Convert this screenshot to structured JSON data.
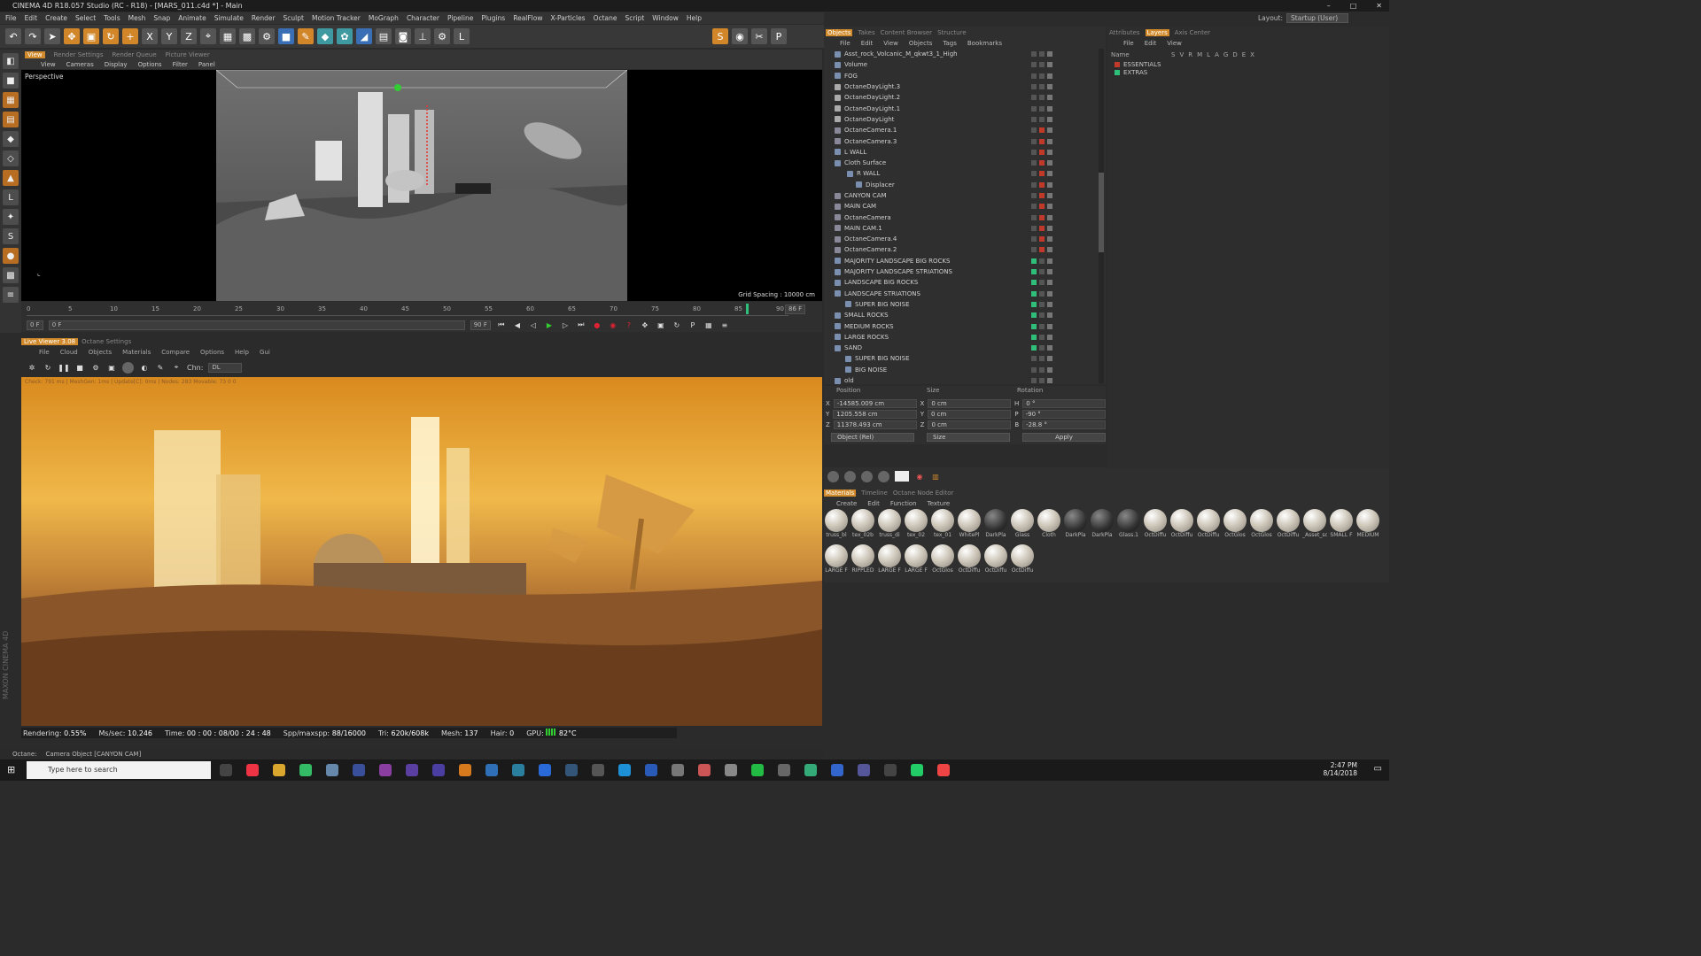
{
  "title": "CINEMA 4D R18.057 Studio (RC - R18) - [MARS_011.c4d *] - Main",
  "menu": [
    "File",
    "Edit",
    "Create",
    "Select",
    "Tools",
    "Mesh",
    "Snap",
    "Animate",
    "Simulate",
    "Render",
    "Sculpt",
    "Motion Tracker",
    "MoGraph",
    "Character",
    "Pipeline",
    "Plugins",
    "RealFlow",
    "X-Particles",
    "Octane",
    "Script",
    "Window",
    "Help"
  ],
  "layout": {
    "label": "Layout:",
    "value": "Startup (User)"
  },
  "vp_tabs": [
    "View",
    "Render Settings",
    "Render Queue",
    "Picture Viewer"
  ],
  "vp_menu": [
    "View",
    "Cameras",
    "Display",
    "Options",
    "Filter",
    "Panel"
  ],
  "viewport": {
    "label": "Perspective",
    "grid": "Grid Spacing : 10000 cm"
  },
  "timeline": {
    "ticks": [
      "0",
      "5",
      "10",
      "15",
      "20",
      "25",
      "30",
      "35",
      "40",
      "45",
      "50",
      "55",
      "60",
      "65",
      "70",
      "75",
      "80",
      "85",
      "90"
    ],
    "current": "86 F",
    "start": "0 F",
    "field1": "0 F",
    "end": "90 F",
    "end2": "90 F"
  },
  "lv_tabs": [
    "Live Viewer 3.08",
    "Octane Settings"
  ],
  "lv_menu": [
    "File",
    "Cloud",
    "Objects",
    "Materials",
    "Compare",
    "Options",
    "Help",
    "Gui"
  ],
  "lv_chn": {
    "label": "Chn:",
    "value": "DL"
  },
  "render_info": "Check: 791 ms | MeshGen: 1ms | Update[C]: 0ms | Nodes: 283 Movable: 73  0 0",
  "stats": {
    "rendering": "Rendering: ",
    "pct": "0.55%",
    "mssec_l": "Ms/sec:",
    "mssec": "10.246",
    "time_l": "Time:",
    "time": "00 : 00 : 08/00 : 24 : 48",
    "spp_l": "Spp/maxspp:",
    "spp": "88/16000",
    "tri_l": "Tri:",
    "tri": "620k/608k",
    "mesh_l": "Mesh:",
    "mesh": "137",
    "hair_l": "Hair:",
    "hair": "0",
    "gpu_l": "GPU:",
    "temp": "82°C"
  },
  "maxon": "MAXON CINEMA 4D",
  "status": {
    "app": "Octane:",
    "msg": "Camera Object [CANYON CAM]"
  },
  "obj_tabs": [
    "Objects",
    "Takes",
    "Content Browser",
    "Structure"
  ],
  "obj_menu": [
    "File",
    "Edit",
    "View",
    "Objects",
    "Tags",
    "Bookmarks"
  ],
  "objects": [
    "Asst_rock_Volcanic_M_qkwt3_1_High",
    "Volume",
    "FOG",
    "OctaneDayLight.3",
    "OctaneDayLight.2",
    "OctaneDayLight.1",
    "OctaneDayLight",
    "OctaneCamera.1",
    "OctaneCamera.3",
    "L WALL",
    "Cloth Surface",
    "R WALL",
    "Displacer",
    "CANYON CAM",
    "MAIN CAM",
    "OctaneCamera",
    "MAIN CAM.1",
    "OctaneCamera.4",
    "OctaneCamera.2",
    "MAJORITY LANDSCAPE BIG ROCKS",
    "MAJORITY LANDSCAPE STRIATIONS",
    "LANDSCAPE BIG ROCKS",
    "LANDSCAPE STRIATIONS",
    "SUPER BIG NOISE",
    "SMALL ROCKS",
    "MEDIUM ROCKS",
    "LARGE ROCKS",
    "SAND",
    "SUPER BIG NOISE",
    "BIG NOISE",
    "old"
  ],
  "coords": {
    "h_pos": "Position",
    "h_size": "Size",
    "h_rot": "Rotation",
    "x": "-14585.009 cm",
    "y": "1205.558 cm",
    "z": "11378.493 cm",
    "sx": "0 cm",
    "sy": "0 cm",
    "sz": "0 cm",
    "h": "0 °",
    "p": "-90 °",
    "b": "-28.8 °",
    "lx": "X",
    "ly": "Y",
    "lz": "Z",
    "lsx": "X",
    "lsy": "Y",
    "lsz": "Z",
    "lh": "H",
    "lp": "P",
    "lb": "B",
    "mode": "Object (Rel)",
    "sizemode": "Size",
    "apply": "Apply"
  },
  "mat_tabs": [
    "Materials",
    "Timeline",
    "Octane Node Editor"
  ],
  "mat_menu": [
    "Create",
    "Edit",
    "Function",
    "Texture"
  ],
  "materials": [
    "truss_bl",
    "tex_02b",
    "truss_di",
    "tex_02",
    "tex_01",
    "WhitePl",
    "DarkPla",
    "Glass",
    "Cloth",
    "DarkPla",
    "DarkPla",
    "Glass.1",
    "OctDiffu",
    "OctDiffu",
    "OctDiffu",
    "OctGlos",
    "OctGlos",
    "OctDiffu",
    "_Asset_sc",
    "SMALL F",
    "MEDIUM",
    "LARGE F",
    "RIPPLED",
    "LARGE F",
    "LARGE F",
    "OctGlos",
    "OctDiffu",
    "OctDiffu",
    "OctDiffu"
  ],
  "attr_tabs": [
    "Attributes",
    "Layers",
    "Axis Center"
  ],
  "attr_menu": [
    "File",
    "Edit",
    "View"
  ],
  "layers_header": {
    "name": "Name",
    "cols": [
      "S",
      "V",
      "R",
      "M",
      "L",
      "A",
      "G",
      "D",
      "E",
      "X"
    ]
  },
  "layers": [
    "ESSENTIALS",
    "EXTRAS"
  ],
  "taskbar": {
    "search": "Type here to search",
    "time": "2:47 PM",
    "date": "8/14/2018"
  },
  "colors": {
    "accent": "#d18a2b",
    "green": "#2fbf7a",
    "red": "#c0392b"
  }
}
